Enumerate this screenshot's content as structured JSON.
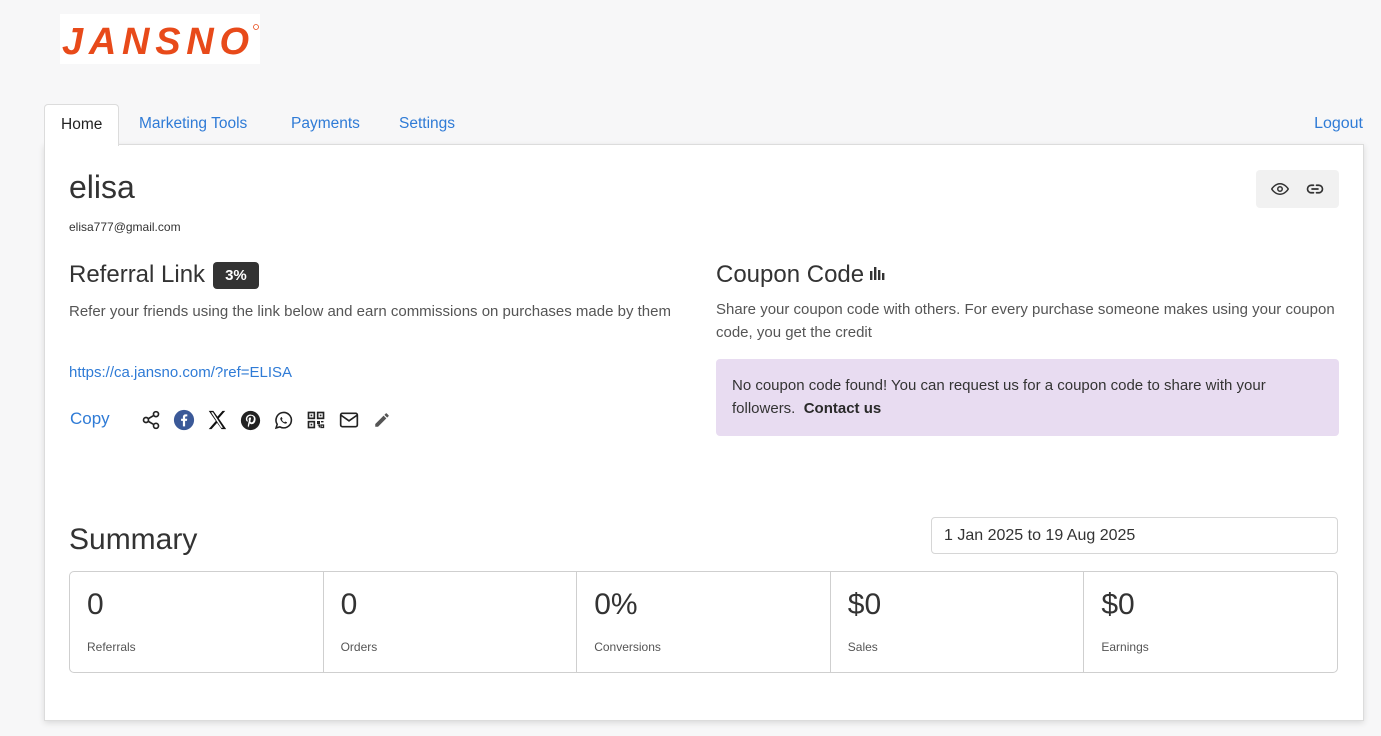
{
  "brand": {
    "logo_text": "JANSNO",
    "logo_color": "#e84a1a"
  },
  "tabs": [
    {
      "label": "Home",
      "active": true
    },
    {
      "label": "Marketing Tools",
      "active": false
    },
    {
      "label": "Payments",
      "active": false
    },
    {
      "label": "Settings",
      "active": false
    }
  ],
  "logout_label": "Logout",
  "profile": {
    "name": "elisa",
    "email": "elisa777@gmail.com"
  },
  "header_icons": [
    "eye-icon",
    "link-icon"
  ],
  "referral": {
    "title": "Referral Link",
    "commission_badge": "3%",
    "description": "Refer your friends using the link below and earn commissions on purchases made by them",
    "link": "https://ca.jansno.com/?ref=ELISA",
    "copy_label": "Copy",
    "share_icons": [
      "share-icon",
      "facebook-icon",
      "x-icon",
      "pinterest-icon",
      "whatsapp-icon",
      "qr-code-icon",
      "email-icon",
      "edit-icon"
    ]
  },
  "coupon": {
    "title": "Coupon Code",
    "title_icon": "bar-chart-icon",
    "description": "Share your coupon code with others. For every purchase someone makes using your coupon code, you get the credit",
    "alert_text": "No coupon code found! You can request us for a coupon code to share with your followers.",
    "alert_link": "Contact us",
    "alert_bg": "#e8dcf1"
  },
  "summary": {
    "title": "Summary",
    "date_range": "1 Jan 2025 to 19 Aug 2025",
    "stats": [
      {
        "value": "0",
        "label": "Referrals"
      },
      {
        "value": "0",
        "label": "Orders"
      },
      {
        "value": "0%",
        "label": "Conversions"
      },
      {
        "value": "$0",
        "label": "Sales"
      },
      {
        "value": "$0",
        "label": "Earnings"
      }
    ]
  },
  "colors": {
    "link": "#2f7bd6",
    "badge": "#333333"
  }
}
